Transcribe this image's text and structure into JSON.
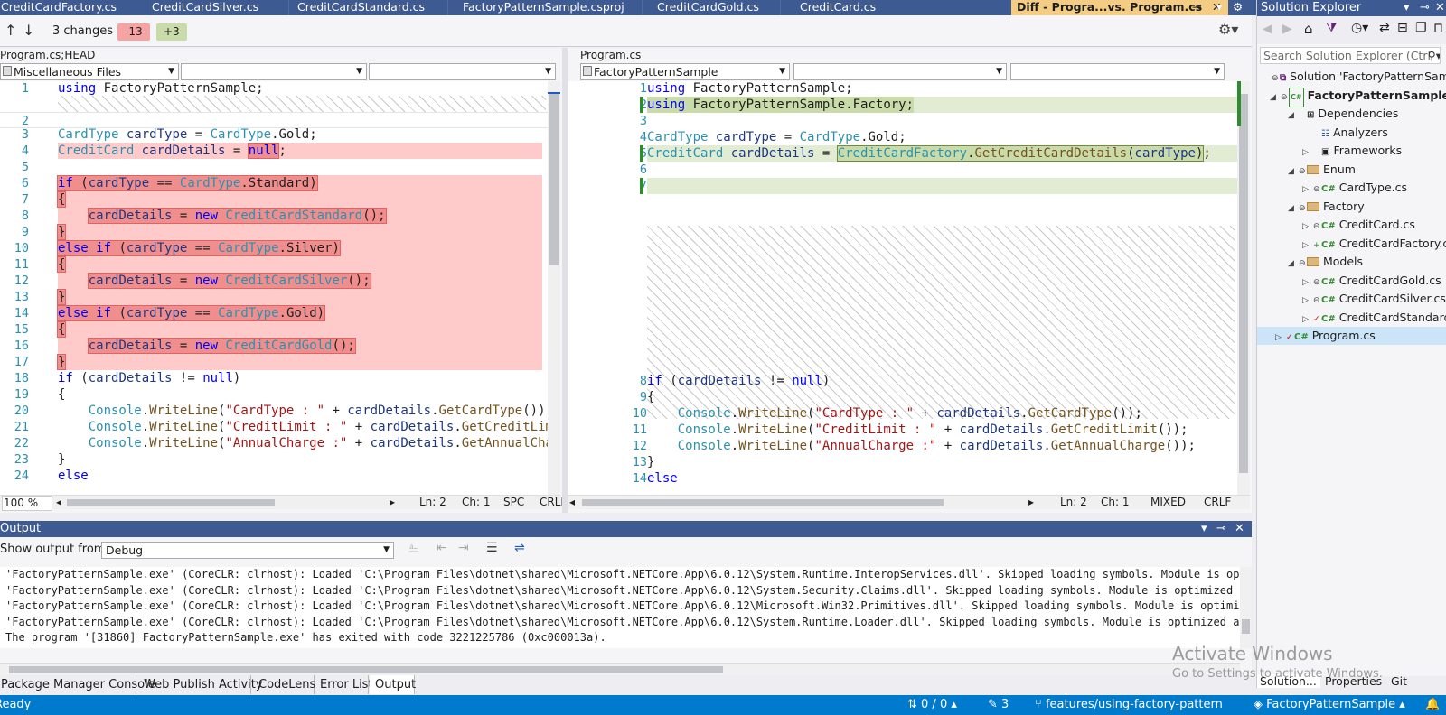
{
  "tabs": [
    {
      "label": "CreditCardFactory.cs"
    },
    {
      "label": "CreditCardSilver.cs"
    },
    {
      "label": "CreditCardStandard.cs"
    },
    {
      "label": "FactoryPatternSample.csproj"
    },
    {
      "label": "CreditCardGold.cs"
    },
    {
      "label": "CreditCard.cs"
    },
    {
      "label": "Diff - Progra...vs. Program.cs"
    }
  ],
  "diff_toolbar": {
    "changes": "3 changes",
    "removed": "-13",
    "added": "+3",
    "colors": {
      "removed": "#f5a3a3",
      "added": "#c9dba8"
    }
  },
  "left": {
    "title": "Program.cs;HEAD",
    "combo1": "Miscellaneous Files",
    "zoom": "100 %",
    "ln": "Ln: 2",
    "ch": "Ch: 1",
    "ws": "SPC",
    "eol": "CRLF",
    "lines": [
      {
        "n": "1",
        "t": "using FactoryPatternSample;"
      },
      {
        "n": "2",
        "t": ""
      },
      {
        "n": "3",
        "t": "CardType cardType = CardType.Gold;"
      },
      {
        "n": "4",
        "t": "CreditCard cardDetails = null;"
      },
      {
        "n": "5",
        "t": ""
      },
      {
        "n": "6",
        "t": "if (cardType == CardType.Standard)"
      },
      {
        "n": "7",
        "t": "{"
      },
      {
        "n": "8",
        "t": "    cardDetails = new CreditCardStandard();"
      },
      {
        "n": "9",
        "t": "}"
      },
      {
        "n": "10",
        "t": "else if (cardType == CardType.Silver)"
      },
      {
        "n": "11",
        "t": "{"
      },
      {
        "n": "12",
        "t": "    cardDetails = new CreditCardSilver();"
      },
      {
        "n": "13",
        "t": "}"
      },
      {
        "n": "14",
        "t": "else if (cardType == CardType.Gold)"
      },
      {
        "n": "15",
        "t": "{"
      },
      {
        "n": "16",
        "t": "    cardDetails = new CreditCardGold();"
      },
      {
        "n": "17",
        "t": "}"
      },
      {
        "n": "18",
        "t": "if (cardDetails != null)"
      },
      {
        "n": "19",
        "t": "{"
      },
      {
        "n": "20",
        "t": "    Console.WriteLine(\"CardType : \" + cardDetails.GetCardType());"
      },
      {
        "n": "21",
        "t": "    Console.WriteLine(\"CreditLimit : \" + cardDetails.GetCreditLimit"
      },
      {
        "n": "22",
        "t": "    Console.WriteLine(\"AnnualCharge :\" + cardDetails.GetAnnualCharg"
      },
      {
        "n": "23",
        "t": "}"
      },
      {
        "n": "24",
        "t": "else"
      }
    ]
  },
  "right": {
    "title": "Program.cs",
    "combo1": "FactoryPatternSample",
    "ln": "Ln: 2",
    "ch": "Ch: 1",
    "ws": "MIXED",
    "eol": "CRLF",
    "lines": [
      {
        "n": "1",
        "t": "using FactoryPatternSample;"
      },
      {
        "n": "2",
        "t": "using FactoryPatternSample.Factory;"
      },
      {
        "n": "3",
        "t": ""
      },
      {
        "n": "4",
        "t": "CardType cardType = CardType.Gold;"
      },
      {
        "n": "5",
        "t": "CreditCard cardDetails = CreditCardFactory.GetCreditCardDetails(cardType);"
      },
      {
        "n": "6",
        "t": ""
      },
      {
        "n": "7",
        "t": ""
      },
      {
        "n": "8",
        "t": "if (cardDetails != null)"
      },
      {
        "n": "9",
        "t": "{"
      },
      {
        "n": "10",
        "t": "    Console.WriteLine(\"CardType : \" + cardDetails.GetCardType());"
      },
      {
        "n": "11",
        "t": "    Console.WriteLine(\"CreditLimit : \" + cardDetails.GetCreditLimit());"
      },
      {
        "n": "12",
        "t": "    Console.WriteLine(\"AnnualCharge :\" + cardDetails.GetAnnualCharge());"
      },
      {
        "n": "13",
        "t": "}"
      },
      {
        "n": "14",
        "t": "else"
      }
    ]
  },
  "solution_explorer": {
    "title": "Solution Explorer",
    "search_placeholder": "Search Solution Explorer (Ctrl",
    "nodes": [
      {
        "label": "Solution 'FactoryPatternSamp"
      },
      {
        "label": "FactoryPatternSample"
      },
      {
        "label": "Dependencies"
      },
      {
        "label": "Analyzers"
      },
      {
        "label": "Frameworks"
      },
      {
        "label": "Enum"
      },
      {
        "label": "CardType.cs"
      },
      {
        "label": "Factory"
      },
      {
        "label": "CreditCard.cs"
      },
      {
        "label": "CreditCardFactory.c"
      },
      {
        "label": "Models"
      },
      {
        "label": "CreditCardGold.cs"
      },
      {
        "label": "CreditCardSilver.cs"
      },
      {
        "label": "CreditCardStandard"
      },
      {
        "label": "Program.cs"
      }
    ],
    "bottom_tabs": [
      "Solution...",
      "Properties",
      "Git Chan..."
    ]
  },
  "output": {
    "title": "Output",
    "show_from_label": "Show output from:",
    "source": "Debug",
    "lines": [
      "'FactoryPatternSample.exe' (CoreCLR: clrhost): Loaded 'C:\\Program Files\\dotnet\\shared\\Microsoft.NETCore.App\\6.0.12\\System.Runtime.InteropServices.dll'. Skipped loading symbols. Module is optimized",
      "'FactoryPatternSample.exe' (CoreCLR: clrhost): Loaded 'C:\\Program Files\\dotnet\\shared\\Microsoft.NETCore.App\\6.0.12\\System.Security.Claims.dll'. Skipped loading symbols. Module is optimized and the",
      "'FactoryPatternSample.exe' (CoreCLR: clrhost): Loaded 'C:\\Program Files\\dotnet\\shared\\Microsoft.NETCore.App\\6.0.12\\Microsoft.Win32.Primitives.dll'. Skipped loading symbols. Module is optimized and",
      "'FactoryPatternSample.exe' (CoreCLR: clrhost): Loaded 'C:\\Program Files\\dotnet\\shared\\Microsoft.NETCore.App\\6.0.12\\System.Runtime.Loader.dll'. Skipped loading symbols. Module is optimized and the d",
      "The program '[31860] FactoryPatternSample.exe' has exited with code 3221225786 (0xc000013a)."
    ]
  },
  "bottom_tabs": [
    "Package Manager Console",
    "Web Publish Activity",
    "CodeLens",
    "Error List",
    "Output"
  ],
  "status": {
    "ready": "Ready",
    "errors": "0 / 0",
    "changes": "3",
    "branch": "features/using-factory-pattern",
    "repo": "FactoryPatternSample"
  },
  "watermark": {
    "title": "Activate Windows",
    "sub": "Go to Settings to activate Windows."
  }
}
